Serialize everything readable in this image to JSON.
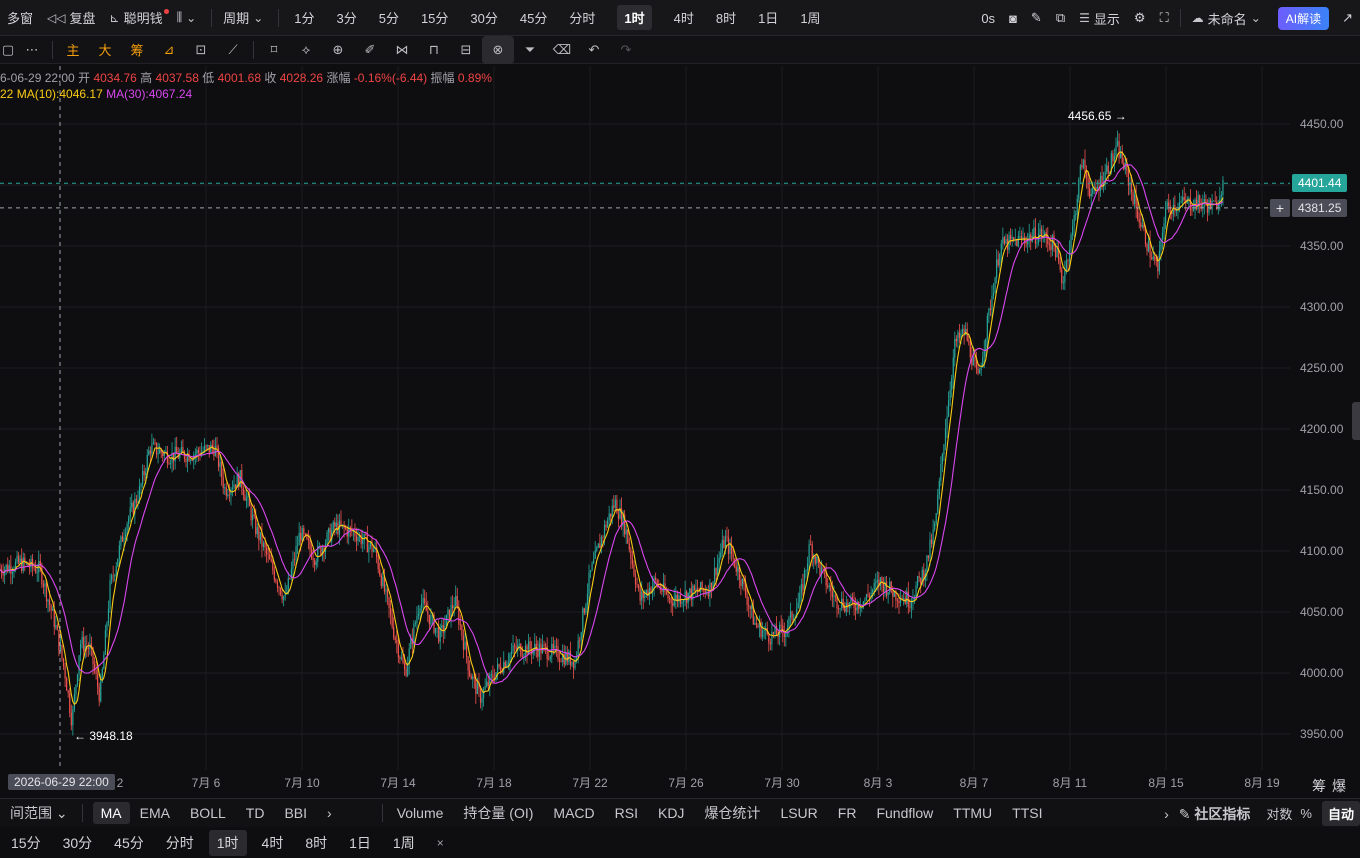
{
  "topbar": {
    "multi_window": "多窗",
    "replay": "复盘",
    "smart_money": "聪明钱",
    "period_label": "周期",
    "intervals": [
      "1分",
      "3分",
      "5分",
      "15分",
      "30分",
      "45分",
      "分时",
      "1时",
      "4时",
      "8时",
      "1日",
      "1周"
    ],
    "active_interval": "1时",
    "countdown": "0s",
    "display_label": "显示",
    "layout_name": "未命名",
    "ai_button": "AI解读"
  },
  "drawbar": {
    "main_label": "主",
    "big_label": "大",
    "chips_label": "筹"
  },
  "legend": {
    "datetime": "6-06-29 22:00",
    "open_label": "开",
    "open": "4034.76",
    "high_label": "高",
    "high": "4037.58",
    "low_label": "低",
    "low": "4001.68",
    "close_label": "收",
    "close": "4028.26",
    "change_label": "涨幅",
    "change": "-0.16%(-6.44)",
    "amp_label": "振幅",
    "amp": "0.89%",
    "ma_prefix": "22",
    "ma10": "MA(10):4046.17",
    "ma30": "MA(30):4067.24"
  },
  "overlay": {
    "last_price": "4401.44",
    "crosshair_price": "4381.25",
    "crosshair_date": "2026-06-29 22:00",
    "corner": "筹爆"
  },
  "indicators": {
    "range_label": "间范围",
    "main": [
      "MA",
      "EMA",
      "BOLL",
      "TD",
      "BBI"
    ],
    "active": "MA",
    "sub": [
      "Volume",
      "持仓量 (OI)",
      "MACD",
      "RSI",
      "KDJ",
      "爆仓统计",
      "LSUR",
      "FR",
      "Fundflow",
      "TTMU",
      "TTSI"
    ],
    "community": "社区指标",
    "log": "对数",
    "percent": "%",
    "auto": "自动"
  },
  "bottom_intervals": {
    "items": [
      "15分",
      "30分",
      "45分",
      "分时",
      "1时",
      "4时",
      "8时",
      "1日",
      "1周"
    ],
    "active": "1时"
  },
  "colors": {
    "up": "#26a69a",
    "down": "#ef5350",
    "ma10": "#facc15",
    "ma30": "#d946ef",
    "background": "#0e0e10"
  },
  "chart_data": {
    "type": "candlestick",
    "ylim": [
      3920,
      4490
    ],
    "yticks": [
      3950,
      4000,
      4050,
      4100,
      4150,
      4200,
      4250,
      4300,
      4350,
      4400,
      4450
    ],
    "xticks": [
      "2",
      "7月 6",
      "7月 10",
      "7月 14",
      "7月 18",
      "7月 22",
      "7月 26",
      "7月 30",
      "8月 3",
      "8月 7",
      "8月 11",
      "8月 15",
      "8月 19"
    ],
    "max_label": "4456.65",
    "min_label": "3948.18",
    "close_path": [
      [
        0,
        4085
      ],
      [
        20,
        4090
      ],
      [
        40,
        4085
      ],
      [
        55,
        4040
      ],
      [
        65,
        4000
      ],
      [
        72,
        3960
      ],
      [
        80,
        4025
      ],
      [
        90,
        4020
      ],
      [
        100,
        3980
      ],
      [
        110,
        4070
      ],
      [
        125,
        4120
      ],
      [
        140,
        4150
      ],
      [
        150,
        4185
      ],
      [
        170,
        4178
      ],
      [
        195,
        4180
      ],
      [
        215,
        4185
      ],
      [
        225,
        4150
      ],
      [
        240,
        4160
      ],
      [
        255,
        4120
      ],
      [
        270,
        4090
      ],
      [
        285,
        4060
      ],
      [
        300,
        4115
      ],
      [
        315,
        4095
      ],
      [
        335,
        4120
      ],
      [
        355,
        4115
      ],
      [
        375,
        4100
      ],
      [
        395,
        4030
      ],
      [
        405,
        4000
      ],
      [
        420,
        4060
      ],
      [
        440,
        4030
      ],
      [
        455,
        4060
      ],
      [
        470,
        4000
      ],
      [
        480,
        3980
      ],
      [
        495,
        4000
      ],
      [
        515,
        4020
      ],
      [
        540,
        4020
      ],
      [
        560,
        4015
      ],
      [
        575,
        4010
      ],
      [
        590,
        4080
      ],
      [
        605,
        4120
      ],
      [
        615,
        4140
      ],
      [
        625,
        4120
      ],
      [
        640,
        4060
      ],
      [
        655,
        4075
      ],
      [
        670,
        4060
      ],
      [
        690,
        4065
      ],
      [
        710,
        4070
      ],
      [
        725,
        4110
      ],
      [
        740,
        4080
      ],
      [
        755,
        4040
      ],
      [
        770,
        4030
      ],
      [
        785,
        4035
      ],
      [
        800,
        4060
      ],
      [
        810,
        4105
      ],
      [
        820,
        4085
      ],
      [
        835,
        4060
      ],
      [
        850,
        4055
      ],
      [
        865,
        4060
      ],
      [
        880,
        4075
      ],
      [
        895,
        4065
      ],
      [
        910,
        4060
      ],
      [
        925,
        4085
      ],
      [
        935,
        4120
      ],
      [
        945,
        4200
      ],
      [
        955,
        4270
      ],
      [
        965,
        4280
      ],
      [
        978,
        4240
      ],
      [
        990,
        4300
      ],
      [
        1000,
        4350
      ],
      [
        1020,
        4355
      ],
      [
        1040,
        4360
      ],
      [
        1055,
        4350
      ],
      [
        1062,
        4320
      ],
      [
        1072,
        4360
      ],
      [
        1082,
        4420
      ],
      [
        1092,
        4390
      ],
      [
        1105,
        4410
      ],
      [
        1118,
        4430
      ],
      [
        1130,
        4400
      ],
      [
        1140,
        4370
      ],
      [
        1150,
        4345
      ],
      [
        1158,
        4330
      ],
      [
        1165,
        4380
      ],
      [
        1180,
        4385
      ],
      [
        1200,
        4385
      ],
      [
        1215,
        4382
      ],
      [
        1222,
        4400
      ]
    ]
  }
}
